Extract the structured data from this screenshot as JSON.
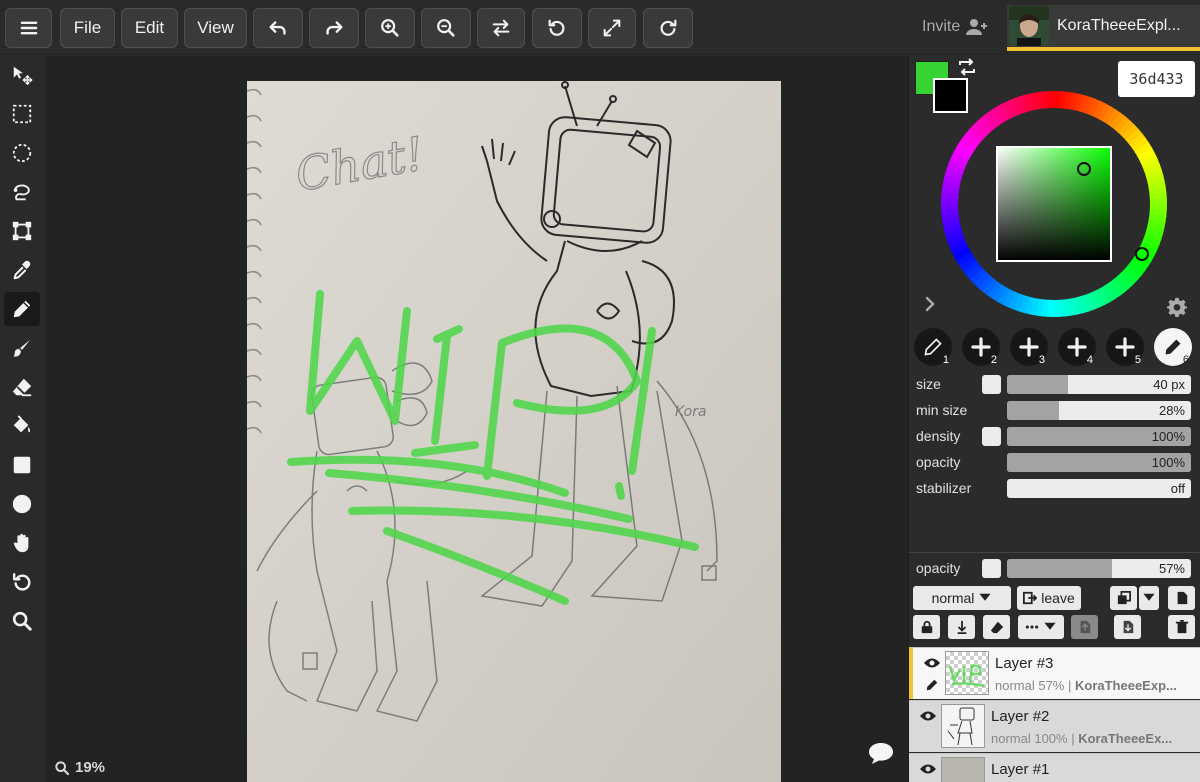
{
  "menu": {
    "file": "File",
    "edit": "Edit",
    "view": "View"
  },
  "header": {
    "invite": "Invite",
    "user_name": "KoraTheeeExpl..."
  },
  "colors": {
    "primary": "#36d433",
    "secondary": "#000000",
    "accent": "#f1c232",
    "wip_stroke": "#4fd64a"
  },
  "color_picker": {
    "hex": "36d433"
  },
  "canvas": {
    "zoom": "19%",
    "sketch_text": "Chat!",
    "wip_text": "WIP!"
  },
  "brush_slots": [
    "1",
    "2",
    "3",
    "4",
    "5",
    "6"
  ],
  "brush_settings": [
    {
      "label": "size",
      "value": "40 px",
      "fill": 0.33,
      "checkbox": true
    },
    {
      "label": "min size",
      "value": "28%",
      "fill": 0.28,
      "checkbox": false
    },
    {
      "label": "density",
      "value": "100%",
      "fill": 1.0,
      "checkbox": true
    },
    {
      "label": "opacity",
      "value": "100%",
      "fill": 1.0,
      "checkbox": false
    },
    {
      "label": "stabilizer",
      "value": "off",
      "fill": 0.0,
      "checkbox": false
    }
  ],
  "layer_controls": {
    "opacity_label": "opacity",
    "opacity_value": "57%",
    "opacity_fill": 0.57,
    "blend_mode": "normal",
    "leave": "leave"
  },
  "layers": [
    {
      "name": "Layer #3",
      "mode": "normal 57%",
      "owner": "KoraTheeeExp...",
      "active": true
    },
    {
      "name": "Layer #2",
      "mode": "normal 100%",
      "owner": "KoraTheeeEx...",
      "active": false
    },
    {
      "name": "Layer #1",
      "mode": "",
      "owner": "",
      "active": false
    }
  ]
}
